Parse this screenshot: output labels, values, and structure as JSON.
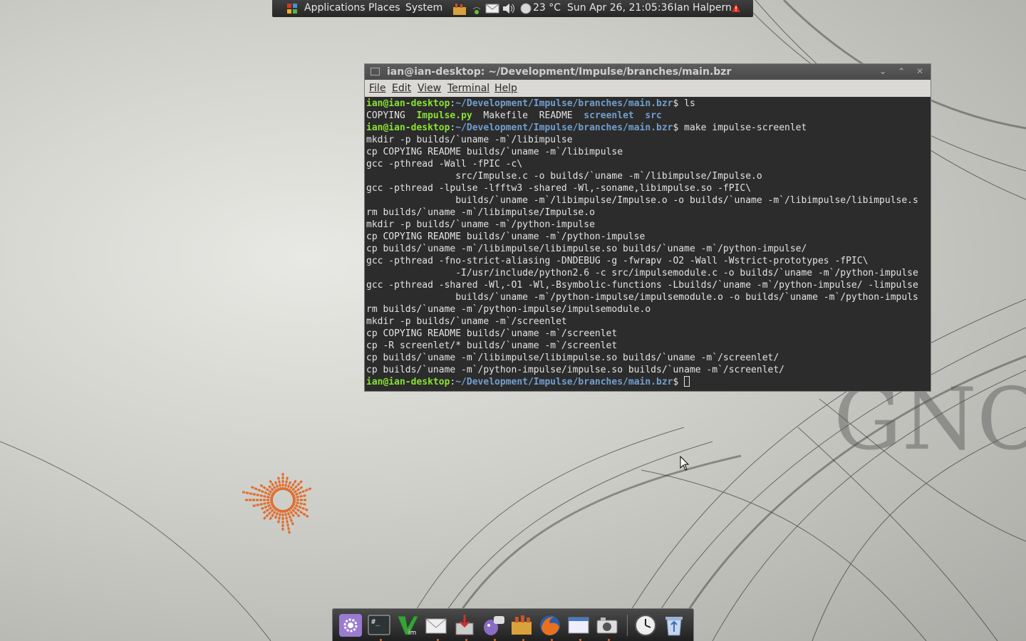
{
  "panel": {
    "applications": "Applications",
    "places": "Places",
    "system": "System",
    "weather": "23 °C",
    "datetime": "Sun Apr 26, 21:05:36",
    "user": "Ian Halpern"
  },
  "terminal": {
    "title": "ian@ian-desktop: ~/Development/Impulse/branches/main.bzr",
    "menu": [
      "File",
      "Edit",
      "View",
      "Terminal",
      "Help"
    ],
    "prompt_user": "ian@ian-desktop",
    "prompt_path": "~/Development/Impulse/branches/main.bzr",
    "cmd1": " ls",
    "ls": {
      "a": "COPYING",
      "b": "Impulse.py",
      "c": "Makefile",
      "d": "README",
      "e": "screenlet",
      "f": "src"
    },
    "cmd2": " make impulse-screenlet",
    "lines": [
      "mkdir -p builds/`uname -m`/libimpulse",
      "cp COPYING README builds/`uname -m`/libimpulse",
      "gcc -pthread -Wall -fPIC -c\\",
      "                src/Impulse.c -o builds/`uname -m`/libimpulse/Impulse.o",
      "gcc -pthread -lpulse -lfftw3 -shared -Wl,-soname,libimpulse.so -fPIC\\",
      "                builds/`uname -m`/libimpulse/Impulse.o -o builds/`uname -m`/libimpulse/libimpulse.s",
      "rm builds/`uname -m`/libimpulse/Impulse.o",
      "mkdir -p builds/`uname -m`/python-impulse",
      "cp COPYING README builds/`uname -m`/python-impulse",
      "cp builds/`uname -m`/libimpulse/libimpulse.so builds/`uname -m`/python-impulse/",
      "gcc -pthread -fno-strict-aliasing -DNDEBUG -g -fwrapv -O2 -Wall -Wstrict-prototypes -fPIC\\",
      "                -I/usr/include/python2.6 -c src/impulsemodule.c -o builds/`uname -m`/python-impulse",
      "gcc -pthread -shared -Wl,-O1 -Wl,-Bsymbolic-functions -Lbuilds/`uname -m`/python-impulse/ -limpulse",
      "                builds/`uname -m`/python-impulse/impulsemodule.o -o builds/`uname -m`/python-impuls",
      "rm builds/`uname -m`/python-impulse/impulsemodule.o",
      "mkdir -p builds/`uname -m`/screenlet",
      "cp COPYING README builds/`uname -m`/screenlet",
      "cp -R screenlet/* builds/`uname -m`/screenlet",
      "cp builds/`uname -m`/libimpulse/libimpulse.so builds/`uname -m`/screenlet/",
      "cp builds/`uname -m`/python-impulse/impulse.so builds/`uname -m`/screenlet/"
    ]
  },
  "dock": {
    "icons": [
      "settings-icon",
      "terminal-icon",
      "vim-icon",
      "mail-icon",
      "installer-icon",
      "pidgin-icon",
      "file-manager-icon",
      "firefox-icon",
      "window-icon",
      "camera-icon",
      "clock-icon",
      "trash-icon"
    ]
  },
  "colors": {
    "prompt_user": "#8ae234",
    "prompt_path": "#729fcf",
    "screenlet": "#e06c2c"
  }
}
